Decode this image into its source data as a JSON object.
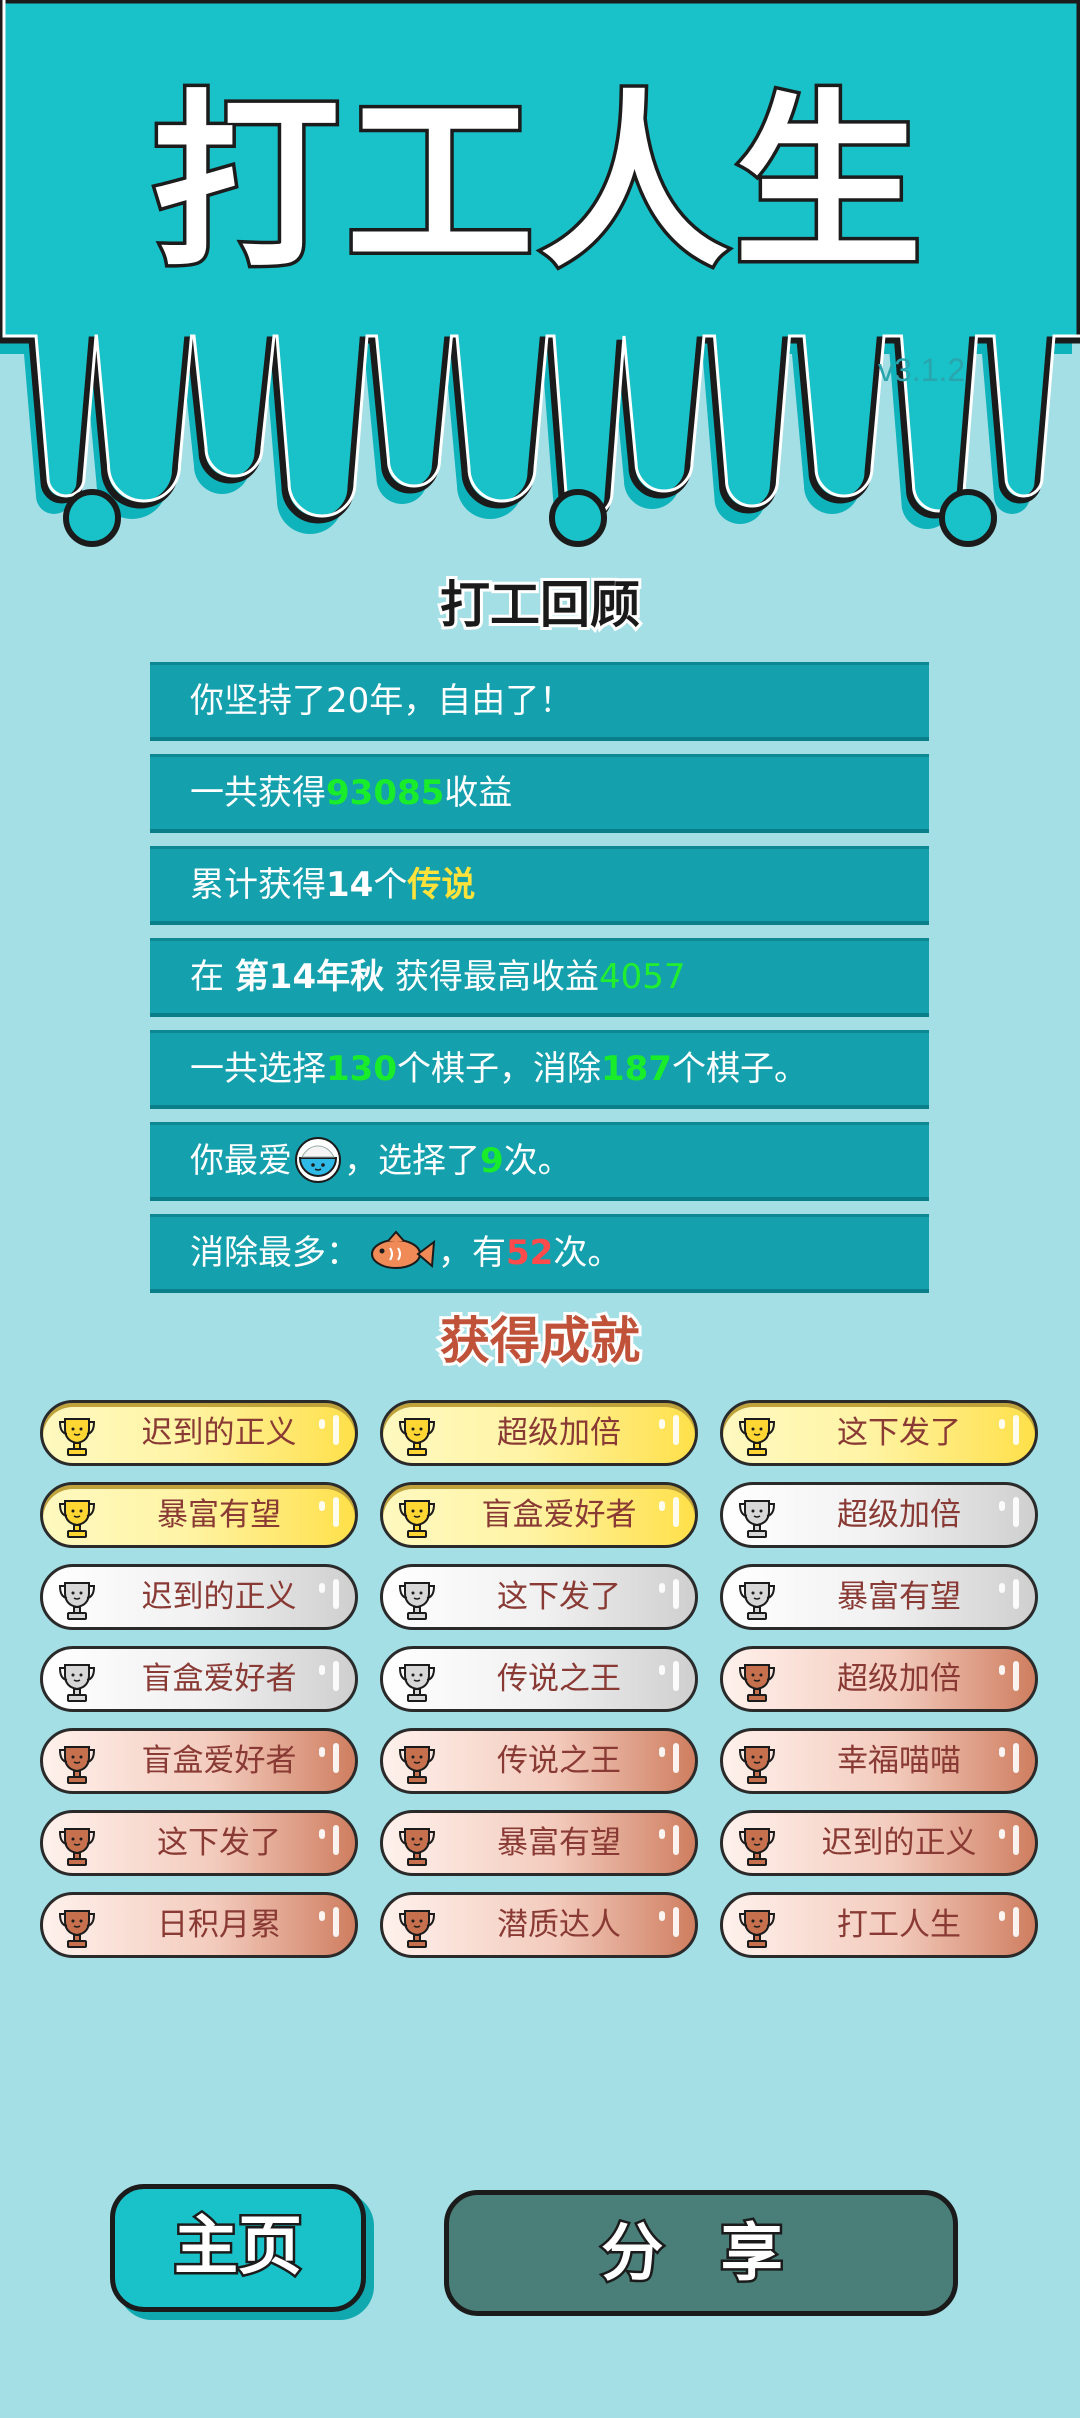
{
  "header": {
    "title": "打工人生",
    "version": "v3.1.2"
  },
  "colors": {
    "teal": "#18c2c8",
    "background": "#a4dfe6",
    "row": "#15a0ad",
    "highlight_green": "#19ec2a",
    "highlight_yellow": "#ffe33a",
    "highlight_red": "#ff4b4b"
  },
  "review": {
    "title": "打工回顾",
    "row1": {
      "text": "你坚持了20年，自由了！"
    },
    "row2": {
      "pre": "一共获得",
      "value": "93085",
      "post": "收益"
    },
    "row3": {
      "pre": "累计获得",
      "count": "14",
      "mid": "个",
      "rarity": "传说"
    },
    "row4": {
      "pre": "在 ",
      "season": "第14年秋",
      "mid": " 获得最高收益",
      "value": "4057"
    },
    "row5": {
      "pre": "一共选择",
      "chosen": "130",
      "mid": "个棋子，消除",
      "removed": "187",
      "post": "个棋子。"
    },
    "row6": {
      "pre": "你最爱",
      "icon": "rice-bowl-icon",
      "mid": "，选择了",
      "count": "9",
      "post": "次。"
    },
    "row7": {
      "pre": "消除最多：",
      "icon": "fish-icon",
      "mid": "，有",
      "count": "52",
      "post": "次。"
    }
  },
  "achievements": {
    "title": "获得成就",
    "items": [
      {
        "label": "迟到的正义",
        "tier": "gold"
      },
      {
        "label": "超级加倍",
        "tier": "gold"
      },
      {
        "label": "这下发了",
        "tier": "gold"
      },
      {
        "label": "暴富有望",
        "tier": "gold"
      },
      {
        "label": "盲盒爱好者",
        "tier": "gold"
      },
      {
        "label": "超级加倍",
        "tier": "silver"
      },
      {
        "label": "迟到的正义",
        "tier": "silver"
      },
      {
        "label": "这下发了",
        "tier": "silver"
      },
      {
        "label": "暴富有望",
        "tier": "silver"
      },
      {
        "label": "盲盒爱好者",
        "tier": "silver"
      },
      {
        "label": "传说之王",
        "tier": "silver"
      },
      {
        "label": "超级加倍",
        "tier": "bronze"
      },
      {
        "label": "盲盒爱好者",
        "tier": "bronze"
      },
      {
        "label": "传说之王",
        "tier": "bronze"
      },
      {
        "label": "幸福喵喵",
        "tier": "bronze"
      },
      {
        "label": "这下发了",
        "tier": "bronze"
      },
      {
        "label": "暴富有望",
        "tier": "bronze"
      },
      {
        "label": "迟到的正义",
        "tier": "bronze"
      },
      {
        "label": "日积月累",
        "tier": "bronze"
      },
      {
        "label": "潜质达人",
        "tier": "bronze"
      },
      {
        "label": "打工人生",
        "tier": "bronze"
      }
    ]
  },
  "buttons": {
    "home": "主页",
    "share": "分 享"
  }
}
